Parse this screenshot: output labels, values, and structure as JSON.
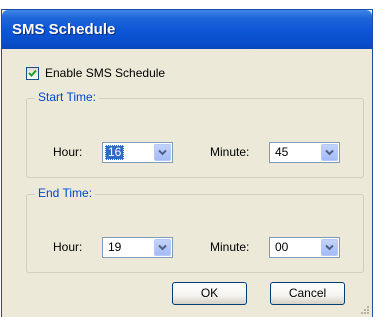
{
  "window": {
    "title": "SMS Schedule"
  },
  "enable": {
    "label": "Enable SMS Schedule",
    "checked": true
  },
  "start_time": {
    "legend": "Start Time:",
    "hour_label": "Hour:",
    "hour_value": "16",
    "minute_label": "Minute:",
    "minute_value": "45"
  },
  "end_time": {
    "legend": "End Time:",
    "hour_label": "Hour:",
    "hour_value": "19",
    "minute_label": "Minute:",
    "minute_value": "00"
  },
  "buttons": {
    "ok": "OK",
    "cancel": "Cancel"
  },
  "colors": {
    "titlebar": "#0a55d6",
    "group_label": "#0046d5",
    "dialog_bg": "#ece9d8",
    "selection": "#316ac5"
  },
  "icons": {
    "checkbox": "check-icon",
    "dropdown": "chevron-down-icon",
    "resize": "resize-grip-icon"
  }
}
